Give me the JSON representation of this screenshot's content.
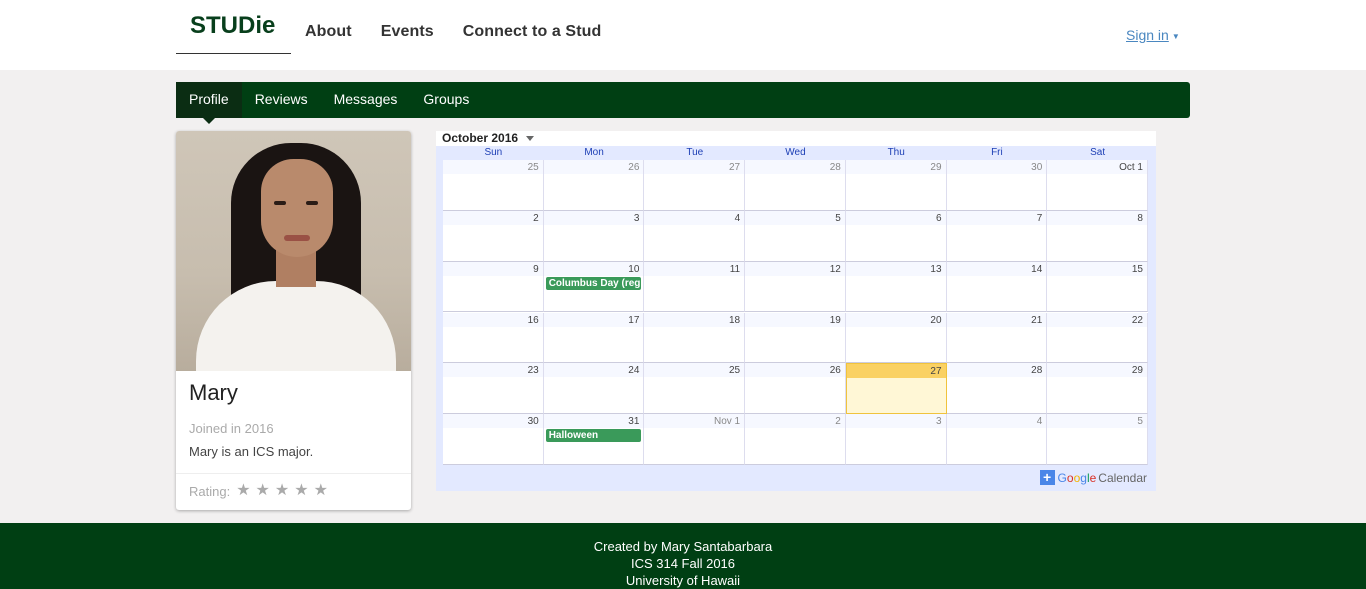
{
  "brand": "STUDie",
  "topnav": [
    "About",
    "Events",
    "Connect to a Stud"
  ],
  "signin": "Sign in",
  "submenu": [
    "Profile",
    "Reviews",
    "Messages",
    "Groups"
  ],
  "profile": {
    "name": "Mary",
    "joined": "Joined in 2016",
    "description": "Mary is an ICS major.",
    "rating_label": "Rating:",
    "rating": 0,
    "rating_max": 5
  },
  "calendar": {
    "month_label": "October 2016",
    "weekdays": [
      "Sun",
      "Mon",
      "Tue",
      "Wed",
      "Thu",
      "Fri",
      "Sat"
    ],
    "weeks": [
      [
        "25",
        "26",
        "27",
        "28",
        "29",
        "30",
        "Oct 1"
      ],
      [
        "2",
        "3",
        "4",
        "5",
        "6",
        "7",
        "8"
      ],
      [
        "9",
        "10",
        "11",
        "12",
        "13",
        "14",
        "15"
      ],
      [
        "16",
        "17",
        "18",
        "19",
        "20",
        "21",
        "22"
      ],
      [
        "23",
        "24",
        "25",
        "26",
        "27",
        "28",
        "29"
      ],
      [
        "30",
        "31",
        "Nov 1",
        "2",
        "3",
        "4",
        "5"
      ]
    ],
    "events": [
      {
        "week": 2,
        "day": 1,
        "title": "Columbus Day (regional holiday)"
      },
      {
        "week": 5,
        "day": 1,
        "title": "Halloween"
      }
    ],
    "today": {
      "week": 4,
      "day": 4
    },
    "event_color": "#3a9a5a",
    "branding": "Google Calendar"
  },
  "footer": [
    "Created by Mary Santabarbara",
    "ICS 314 Fall 2016",
    "University of Hawaii"
  ]
}
